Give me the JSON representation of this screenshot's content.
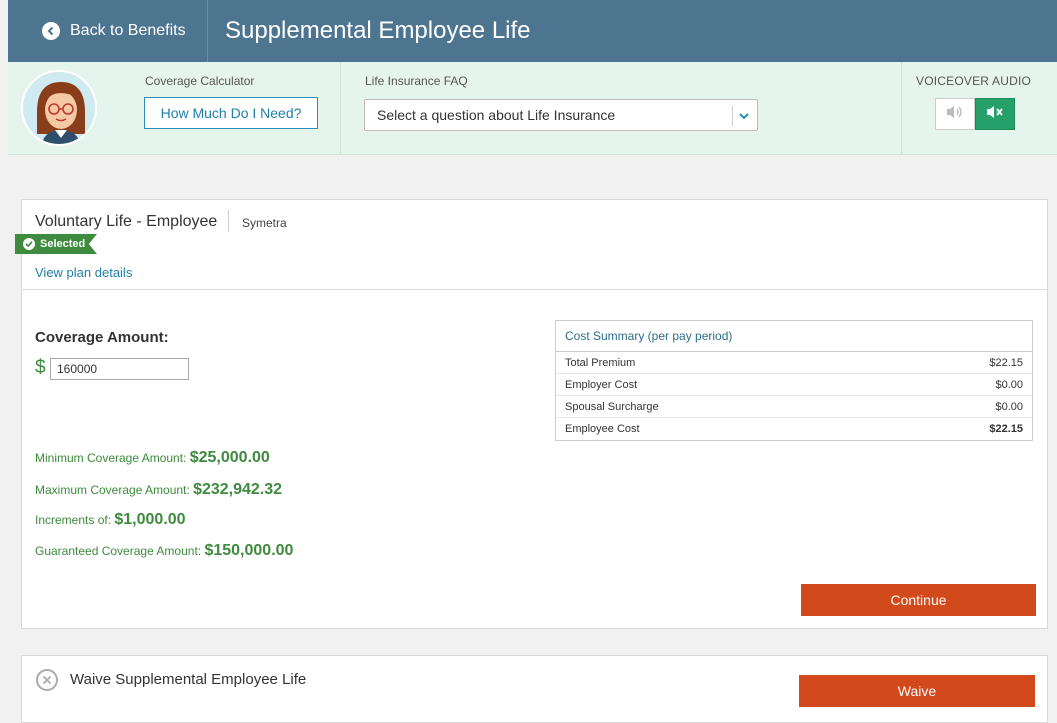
{
  "header": {
    "back_label": "Back to Benefits",
    "title": "Supplemental Employee Life"
  },
  "toolbar": {
    "calculator_label": "Coverage Calculator",
    "calculator_button": "How Much Do I Need?",
    "faq_label": "Life Insurance FAQ",
    "faq_select_value": "Select a question about Life Insurance",
    "voiceover_label": "VOICEOVER AUDIO",
    "voiceover_state": "muted"
  },
  "plan": {
    "name": "Voluntary Life - Employee",
    "carrier": "Symetra",
    "status_badge": "Selected",
    "view_details": "View plan details",
    "coverage_label": "Coverage Amount:",
    "currency_symbol": "$",
    "coverage_value": "160000",
    "stats": [
      {
        "label": "Minimum Coverage Amount: ",
        "value": "$25,000.00"
      },
      {
        "label": "Maximum Coverage Amount: ",
        "value": "$232,942.32"
      },
      {
        "label": "Increments of: ",
        "value": "$1,000.00"
      },
      {
        "label": "Guaranteed Coverage Amount: ",
        "value": "$150,000.00"
      }
    ],
    "cost_summary": {
      "title": "Cost Summary (per pay period)",
      "rows": [
        {
          "label": "Total Premium",
          "amount": "$22.15"
        },
        {
          "label": "Employer Cost",
          "amount": "$0.00"
        },
        {
          "label": "Spousal Surcharge",
          "amount": "$0.00"
        },
        {
          "label": "Employee Cost",
          "amount": "$22.15"
        }
      ]
    },
    "continue_label": "Continue"
  },
  "waive": {
    "text": "Waive Supplemental Employee Life",
    "button": "Waive"
  },
  "colors": {
    "header_bg": "#4e7590",
    "toolbar_bg": "#e6f4ee",
    "accent_green": "#3e8a3e",
    "action_orange": "#d2491b",
    "link_blue": "#1f7fa5"
  }
}
